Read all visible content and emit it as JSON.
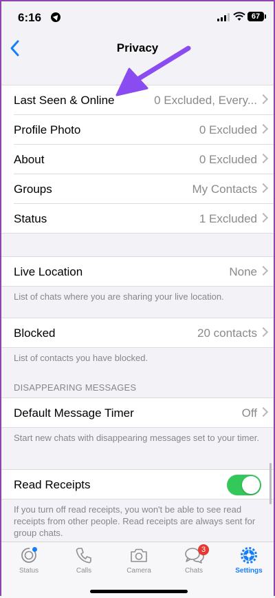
{
  "status": {
    "time": "6:16",
    "battery": "67"
  },
  "nav": {
    "title": "Privacy"
  },
  "privacy_items": [
    {
      "label": "Last Seen & Online",
      "value": "0 Excluded, Every..."
    },
    {
      "label": "Profile Photo",
      "value": "0 Excluded"
    },
    {
      "label": "About",
      "value": "0 Excluded"
    },
    {
      "label": "Groups",
      "value": "My Contacts"
    },
    {
      "label": "Status",
      "value": "1 Excluded"
    }
  ],
  "live_location": {
    "label": "Live Location",
    "value": "None",
    "footnote": "List of chats where you are sharing your live location."
  },
  "blocked": {
    "label": "Blocked",
    "value": "20 contacts",
    "footnote": "List of contacts you have blocked."
  },
  "disappearing": {
    "header": "DISAPPEARING MESSAGES",
    "label": "Default Message Timer",
    "value": "Off",
    "footnote": "Start new chats with disappearing messages set to your timer."
  },
  "read_receipts": {
    "label": "Read Receipts",
    "enabled": true,
    "footnote": "If you turn off read receipts, you won't be able to see read receipts from other people. Read receipts are always sent for group chats."
  },
  "tabs": [
    {
      "label": "Status",
      "icon": "status-icon"
    },
    {
      "label": "Calls",
      "icon": "phone-icon"
    },
    {
      "label": "Camera",
      "icon": "camera-icon"
    },
    {
      "label": "Chats",
      "icon": "chat-bubbles-icon",
      "badge": "3"
    },
    {
      "label": "Settings",
      "icon": "settings-gear-icon",
      "active": true
    }
  ],
  "colors": {
    "accent": "#147efb",
    "toggle_on": "#34c759",
    "badge": "#e53935",
    "annotation_arrow": "#8a4cf0"
  }
}
